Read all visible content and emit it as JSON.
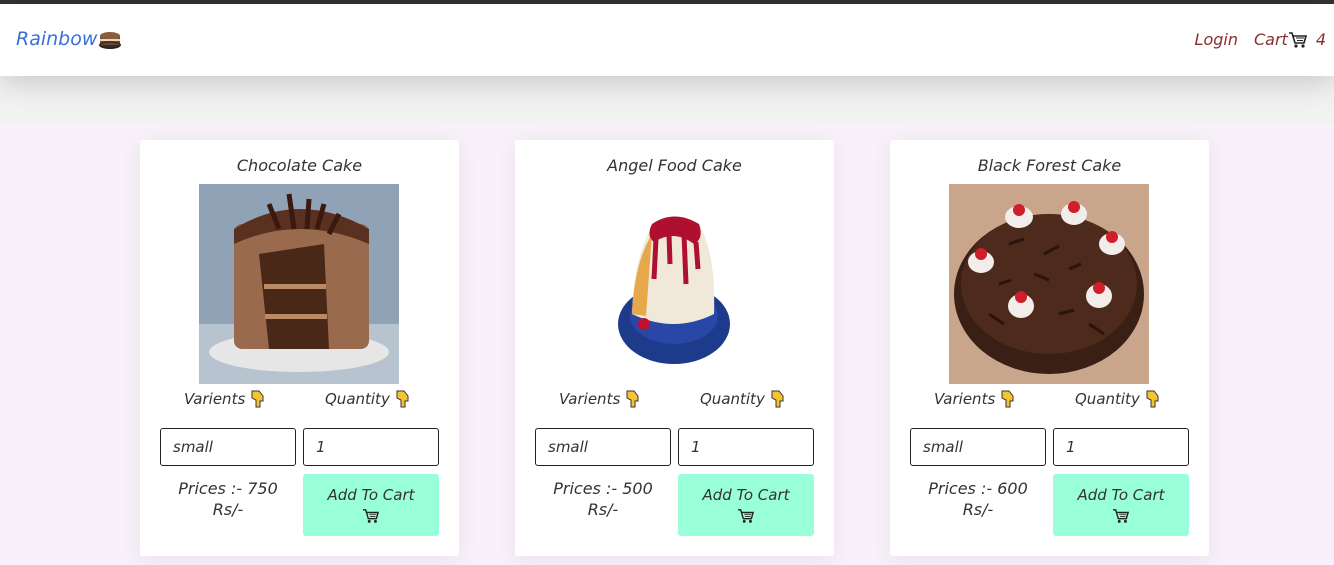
{
  "navbar": {
    "brand": "Rainbow",
    "brand_icon": "cake-icon",
    "login": "Login",
    "cart_label": "Cart",
    "cart_icon": "cart-icon",
    "cart_count": "4"
  },
  "labels": {
    "variants": "Varients",
    "quantity": "Quantity",
    "add_to_cart": "Add To Cart"
  },
  "products": [
    {
      "name": "Chocolate Cake",
      "variant": "small",
      "quantity": "1",
      "price_line1": "Prices :- 750",
      "price_line2": "Rs/-",
      "image": "chocolate-cake"
    },
    {
      "name": "Angel Food Cake",
      "variant": "small",
      "quantity": "1",
      "price_line1": "Prices :- 500",
      "price_line2": "Rs/-",
      "image": "angel-food-cake"
    },
    {
      "name": "Black Forest Cake",
      "variant": "small",
      "quantity": "1",
      "price_line1": "Prices :- 600",
      "price_line2": "Rs/-",
      "image": "black-forest-cake"
    }
  ]
}
